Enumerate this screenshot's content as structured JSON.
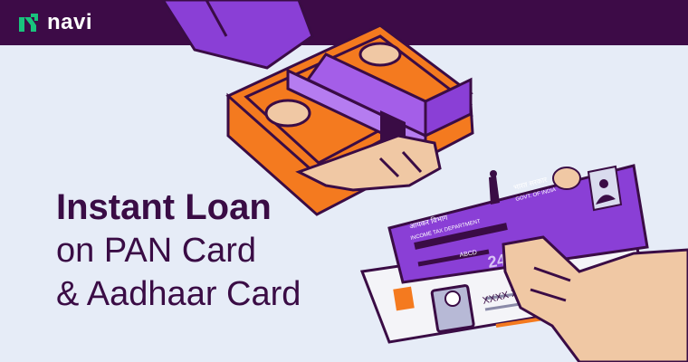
{
  "brand": {
    "name": "navi",
    "colors": {
      "dark_purple": "#3d0b47",
      "violet": "#8b3fd6",
      "orange": "#f47a1f",
      "background": "#e6ecf7",
      "logo_green": "#19c37d"
    }
  },
  "headline": {
    "line1": "Instant Loan",
    "line2": "on PAN Card",
    "line3": "& Aadhaar Card"
  },
  "pan_card": {
    "header_hindi_left": "आयकर विभाग",
    "header_english_left": "INCOME TAX DEPARTMENT",
    "header_hindi_right": "भारत सरकार",
    "header_english_right": "GOVT. OF INDIA",
    "number_label": "ABCD",
    "number_digits": "24",
    "masked": "XXXX XXXX"
  },
  "icons": [
    "navi-logo-icon",
    "cash-stack-icon",
    "pan-card-icon",
    "aadhaar-card-icon",
    "emblem-icon",
    "photo-icon"
  ]
}
